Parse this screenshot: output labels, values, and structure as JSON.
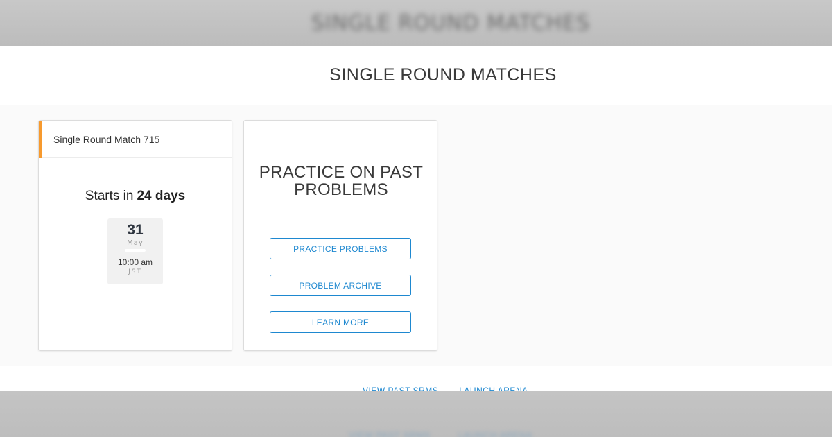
{
  "background": {
    "blurred_title": "SINGLE ROUND MATCHES",
    "blurred_links": [
      "VIEW PAST SRMS",
      "LAUNCH ARENA"
    ]
  },
  "header": {
    "title": "SINGLE ROUND MATCHES"
  },
  "srm_card": {
    "title": "Single Round Match 715",
    "starts_prefix": "Starts in",
    "starts_value": "24 days",
    "date": {
      "day": "31",
      "month": "May",
      "time": "10:00 am",
      "timezone": "JST"
    },
    "accent_color": "#f79a2e"
  },
  "practice_card": {
    "title": "PRACTICE ON PAST PROBLEMS",
    "buttons": [
      "PRACTICE PROBLEMS",
      "PROBLEM ARCHIVE",
      "LEARN MORE"
    ],
    "button_color": "#1e88d0"
  },
  "footer": {
    "links": [
      "VIEW PAST SRMS",
      "LAUNCH ARENA"
    ]
  }
}
